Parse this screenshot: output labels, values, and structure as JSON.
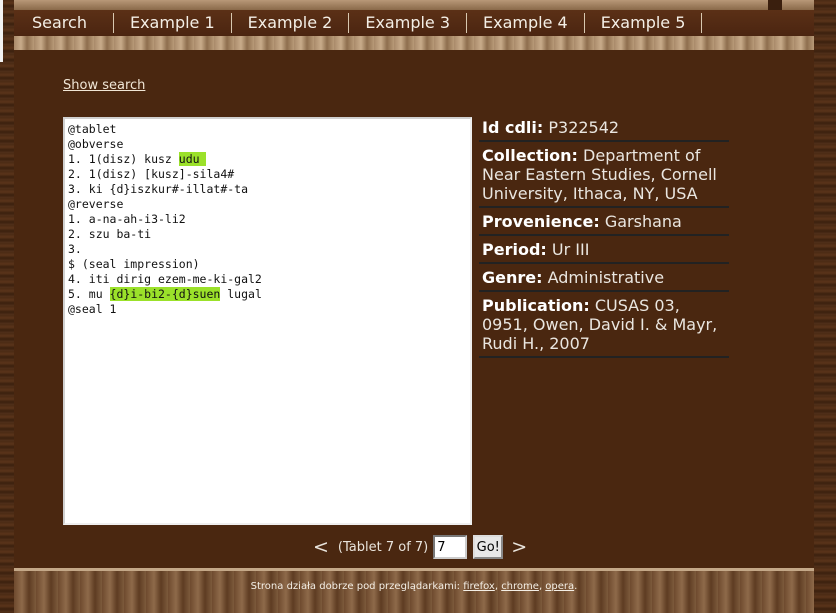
{
  "nav": {
    "items": [
      "Search",
      "Example 1",
      "Example 2",
      "Example 3",
      "Example 4",
      "Example 5"
    ]
  },
  "show_search": "Show search",
  "transliteration": {
    "lines": [
      [
        "@tablet"
      ],
      [
        "@obverse"
      ],
      [
        "1. 1(disz) kusz ",
        {
          "hl": "udu "
        }
      ],
      [
        "2. 1(disz) [kusz]-sila4#"
      ],
      [
        "3. ki {d}iszkur#-illat#-ta"
      ],
      [
        "@reverse"
      ],
      [
        "1. a-na-ah-i3-li2"
      ],
      [
        "2. szu ba-ti"
      ],
      [
        "3."
      ],
      [
        "$ (seal impression)"
      ],
      [
        "4. iti dirig ezem-me-ki-gal2"
      ],
      [
        "5. mu ",
        {
          "hl": "{d}i-bi2-{d}suen"
        },
        " lugal"
      ],
      [
        "@seal 1"
      ]
    ],
    "highlight_color": "#9be12a"
  },
  "metadata": [
    {
      "label": "Id cdli:",
      "value": "P322542"
    },
    {
      "label": "Collection:",
      "value": "Department of Near Eastern Studies, Cornell University, Ithaca, NY, USA"
    },
    {
      "label": "Provenience:",
      "value": "Garshana"
    },
    {
      "label": "Period:",
      "value": "Ur III"
    },
    {
      "label": "Genre:",
      "value": "Administrative"
    },
    {
      "label": "Publication:",
      "value": "CUSAS 03, 0951, Owen, David I. & Mayr, Rudi H., 2007"
    }
  ],
  "pager": {
    "prev": "<",
    "info": "(Tablet 7 of 7)",
    "input_value": "7",
    "go_label": "Go!",
    "next": ">"
  },
  "footer": {
    "prefix": "Strona działa dobrze pod przeglądarkami: ",
    "browsers": [
      "firefox",
      "chrome",
      "opera"
    ],
    "sep": ", ",
    "suffix": "."
  }
}
